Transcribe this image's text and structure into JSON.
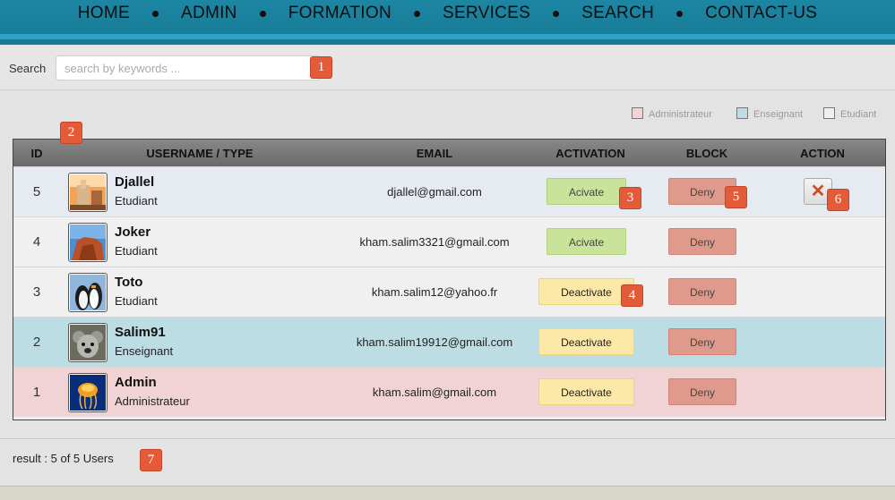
{
  "nav": {
    "items": [
      "HOME",
      "ADMIN",
      "FORMATION",
      "SERVICES",
      "SEARCH",
      "CONTACT-US"
    ]
  },
  "search": {
    "label": "Search",
    "placeholder": "search by keywords ...",
    "value": ""
  },
  "legend": [
    {
      "label": "Administrateur",
      "color": "#f2d3d5"
    },
    {
      "label": "Enseignant",
      "color": "#bcdde3"
    },
    {
      "label": "Etudiant",
      "color": "#f0f0f0"
    }
  ],
  "table": {
    "headers": {
      "id": "ID",
      "username": "USERNAME / TYPE",
      "email": "EMAIL",
      "activation": "ACTIVATION",
      "block": "BLOCK",
      "action": "ACTION"
    },
    "rows": [
      {
        "id": "5",
        "username": "Djallel",
        "type": "Etudiant",
        "email": "djallel@gmail.com",
        "activation": "Acivate",
        "block": "Deny",
        "action_icon": "close-icon",
        "bg": "#e6ebf2"
      },
      {
        "id": "4",
        "username": "Joker",
        "type": "Etudiant",
        "email": "kham.salim3321@gmail.com",
        "activation": "Acivate",
        "block": "Deny",
        "bg": "#f0f0f0"
      },
      {
        "id": "3",
        "username": "Toto",
        "type": "Etudiant",
        "email": "kham.salim12@yahoo.fr",
        "activation": "Deactivate",
        "block": "Deny",
        "bg": "#f0f0f0"
      },
      {
        "id": "2",
        "username": "Salim91",
        "type": "Enseignant",
        "email": "kham.salim19912@gmail.com",
        "activation": "Deactivate",
        "block": "Deny",
        "bg": "#bcdde3"
      },
      {
        "id": "1",
        "username": "Admin",
        "type": "Administrateur",
        "email": "kham.salim@gmail.com",
        "activation": "Deactivate",
        "block": "Deny",
        "bg": "#f2d3d5"
      }
    ]
  },
  "footer": {
    "text": "result : 5 of 5 Users"
  },
  "annotations": [
    "1",
    "2",
    "3",
    "4",
    "5",
    "6",
    "7"
  ]
}
